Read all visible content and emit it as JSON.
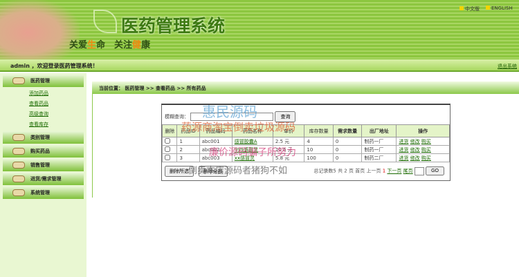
{
  "header": {
    "logo": "医药管理系统",
    "slogan_a": "关爱",
    "slogan_b": "生",
    "slogan_c": "命　关注",
    "slogan_d": "健",
    "slogan_e": "康",
    "lang_cn": "中文版",
    "lang_en": "ENGLISH"
  },
  "welcome": {
    "text": "admin ，欢迎登录医药管理系统！",
    "logout": "退出系统"
  },
  "sidebar": {
    "menus": [
      {
        "label": "医药管理",
        "subs": [
          "添加药品",
          "查看药品",
          "高级查询",
          "查看库存"
        ]
      },
      {
        "label": "类别管理"
      },
      {
        "label": "购买药品"
      },
      {
        "label": "销售管理"
      },
      {
        "label": "进货/需求管理"
      },
      {
        "label": "系统管理"
      }
    ]
  },
  "breadcrumb": "当前位置： 医药管理 >> 查看药品 >> 所有药品",
  "search": {
    "label": "模糊查询：",
    "button": "查询"
  },
  "table": {
    "headers": [
      "删除",
      "药品ID",
      "药品编码",
      "药品名称",
      "单价",
      "库存数量",
      "需求数量",
      "出厂地址",
      "操作"
    ],
    "rows": [
      [
        "1",
        "abc001",
        "感冒胶囊A",
        "2.5 元",
        "4",
        "0",
        "制药一厂"
      ],
      [
        "2",
        "abc002",
        "999感冒灵",
        "10.5 元",
        "10",
        "0",
        "制药一厂"
      ],
      [
        "3",
        "abc003",
        "xx感冒灵",
        "5.8 元",
        "100",
        "0",
        "制药二厂"
      ]
    ],
    "actions": [
      "进货",
      "修改",
      "购买"
    ]
  },
  "footer": {
    "delete_selected": "删除所选",
    "delete_all": "删除全部",
    "total": "总记录数5 共 2 页",
    "first": "首页",
    "prev": "上一页",
    "current": "1",
    "next": "下一页",
    "last": "尾页",
    "go": "GO"
  },
  "watermarks": [
    "惠民源码",
    "药源商淘宝倒卖垃圾源码",
    "廉价源码骗子所努力",
    "倒卖本店源码者猪狗不如"
  ]
}
